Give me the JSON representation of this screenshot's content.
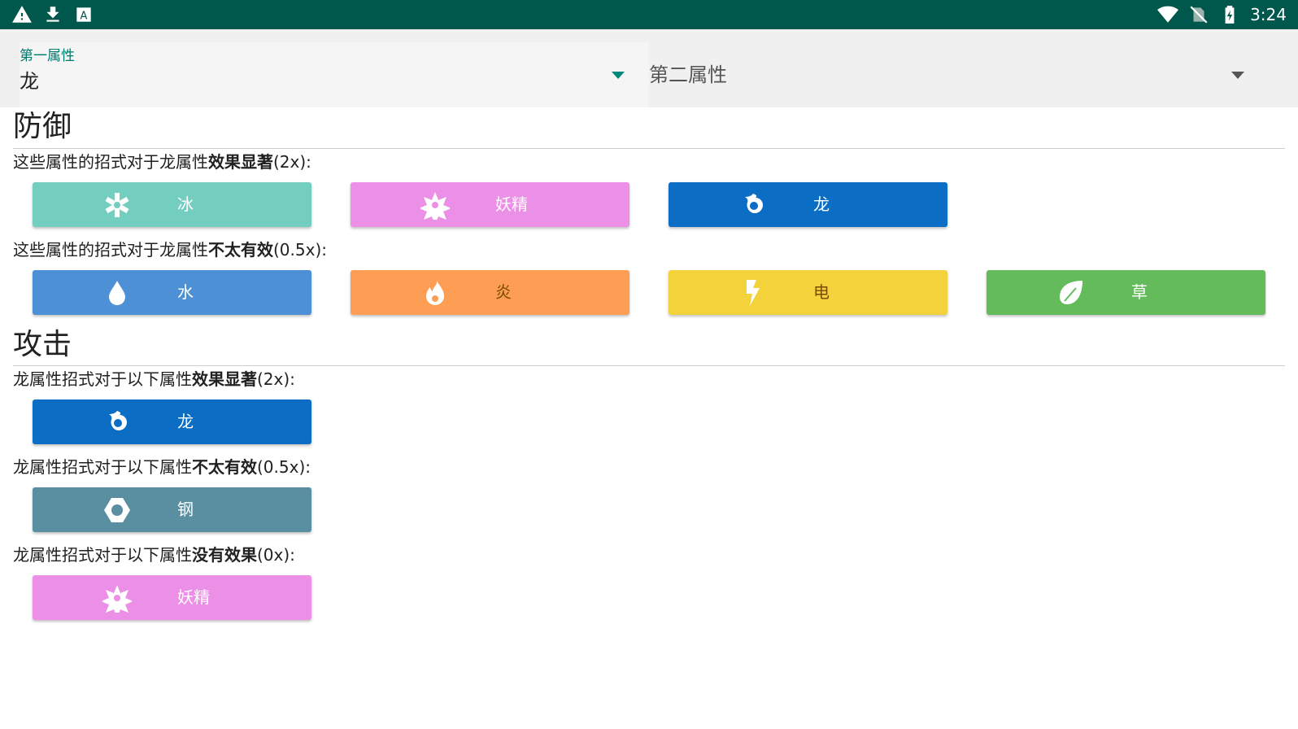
{
  "status_bar": {
    "icons_left": [
      "warning-icon",
      "download-icon",
      "keyboard-icon"
    ],
    "icons_right": [
      "wifi-icon",
      "no-sim-icon",
      "battery-charging-icon"
    ],
    "time": "3:24"
  },
  "selectors": {
    "first": {
      "label": "第一属性",
      "value": "龙"
    },
    "second": {
      "placeholder": "第二属性"
    }
  },
  "defense": {
    "title": "防御",
    "super_effective": {
      "prefix": "这些属性的招式对于龙属性",
      "emphasis": "效果显著",
      "suffix": "(2x):",
      "types": [
        {
          "name": "冰",
          "icon": "snowflake-icon",
          "color": "#74cec0"
        },
        {
          "name": "妖精",
          "icon": "fairy-star-icon",
          "color": "#ec8fe6"
        },
        {
          "name": "龙",
          "icon": "dragon-icon",
          "color": "#0b6dc3"
        }
      ]
    },
    "not_very_effective": {
      "prefix": "这些属性的招式对于龙属性",
      "emphasis": "不太有效",
      "suffix": "(0.5x):",
      "types": [
        {
          "name": "水",
          "icon": "water-drop-icon",
          "color": "#4d90d5"
        },
        {
          "name": "炎",
          "icon": "fire-icon",
          "color": "#fe9d54"
        },
        {
          "name": "电",
          "icon": "lightning-icon",
          "color": "#f3d23b"
        },
        {
          "name": "草",
          "icon": "leaf-icon",
          "color": "#63bb5b"
        }
      ]
    }
  },
  "attack": {
    "title": "攻击",
    "super_effective": {
      "prefix": "龙属性招式对于以下属性",
      "emphasis": "效果显著",
      "suffix": "(2x):",
      "types": [
        {
          "name": "龙",
          "icon": "dragon-icon",
          "color": "#0b6dc3"
        }
      ]
    },
    "not_very_effective": {
      "prefix": "龙属性招式对于以下属性",
      "emphasis": "不太有效",
      "suffix": "(0.5x):",
      "types": [
        {
          "name": "钢",
          "icon": "steel-hexagon-icon",
          "color": "#5a8ea1"
        }
      ]
    },
    "no_effect": {
      "prefix": "龙属性招式对于以下属性",
      "emphasis": "没有效果",
      "suffix": "(0x):",
      "types": [
        {
          "name": "妖精",
          "icon": "fairy-star-icon",
          "color": "#ec8fe6"
        }
      ]
    }
  }
}
